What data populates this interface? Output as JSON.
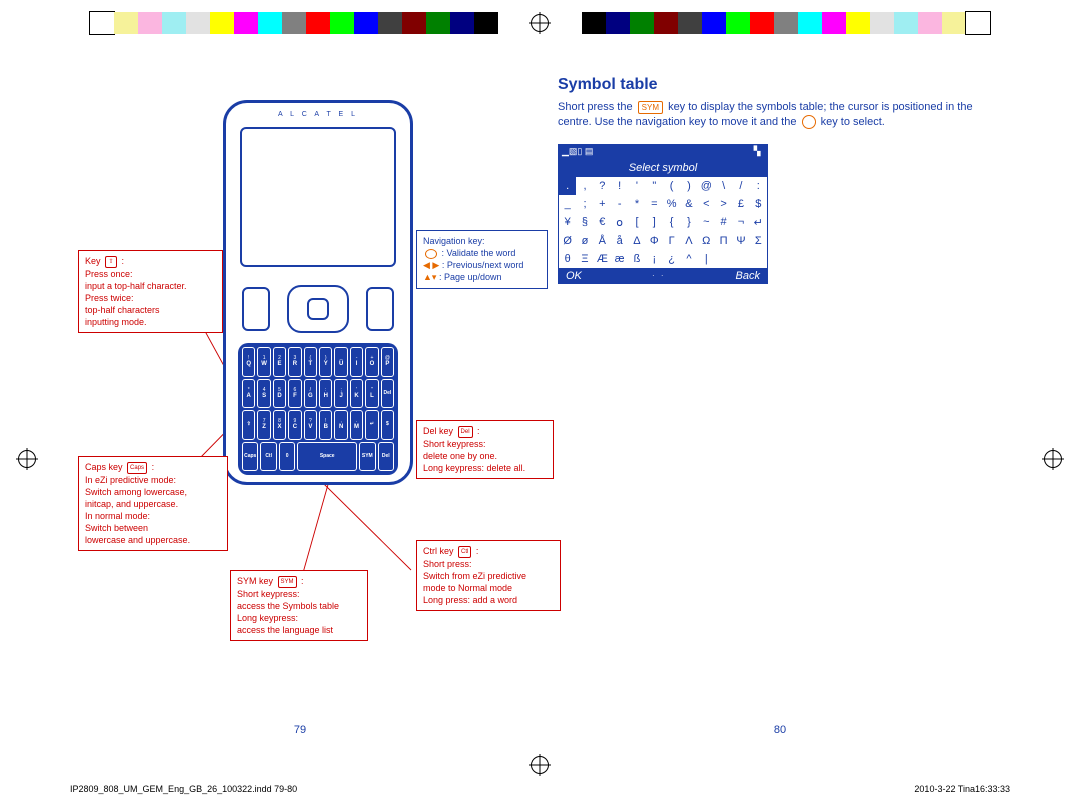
{
  "phone_brand": "A L C A T E L",
  "left": {
    "page_number": "79",
    "key_callout": {
      "title": "Key",
      "keycap": "⇧",
      "line1": "Press once:",
      "line2": "input a top-half character.",
      "line3": "Press twice:",
      "line4": "top-half characters",
      "line5": "inputting mode."
    },
    "caps_callout": {
      "title": "Caps key",
      "keycap": "Caps",
      "line1": "In eZi predictive mode:",
      "line2": "Switch among lowercase,",
      "line3": "initcap, and uppercase.",
      "line4": "In normal mode:",
      "line5": "Switch between",
      "line6": "lowercase and uppercase."
    },
    "sym_callout": {
      "title": "SYM key",
      "keycap": "SYM",
      "line1": "Short keypress:",
      "line2": "access the Symbols table",
      "line3": "Long keypress:",
      "line4": "access the language list"
    },
    "nav_callout": {
      "title": "Navigation key:",
      "ok_label": ": Validate the word",
      "lr_label": ": Previous/next word",
      "ud_label": ": Page up/down"
    },
    "del_callout": {
      "title": "Del key",
      "keycap": "Del",
      "line1": "Short keypress:",
      "line2": "delete one by one.",
      "line3": "Long keypress: delete all."
    },
    "ctrl_callout": {
      "title": "Ctrl key",
      "keycap": "Ctl",
      "line1": "Short press:",
      "line2": "Switch from eZi predictive",
      "line3": "mode to Normal mode",
      "line4": "Long press: add a word"
    },
    "keyboard": [
      [
        [
          "!",
          "Q"
        ],
        [
          "1",
          "W"
        ],
        [
          "2",
          "E"
        ],
        [
          "3",
          "R"
        ],
        [
          "(",
          "T"
        ],
        [
          ")",
          "Y"
        ],
        [
          "_",
          "U"
        ],
        [
          "-",
          "I"
        ],
        [
          "+",
          "O"
        ],
        [
          "@",
          "P"
        ]
      ],
      [
        [
          "*",
          "A"
        ],
        [
          "4",
          "S"
        ],
        [
          "5",
          "D"
        ],
        [
          "6",
          "F"
        ],
        [
          "/",
          "G"
        ],
        [
          ":",
          "H"
        ],
        [
          ";",
          "J"
        ],
        [
          "'",
          "K"
        ],
        [
          "\"",
          "L"
        ],
        [
          "Del",
          ""
        ]
      ],
      [
        [
          "⇧",
          ""
        ],
        [
          "7",
          "Z"
        ],
        [
          "8",
          "X"
        ],
        [
          "9",
          "C"
        ],
        [
          "?",
          "V"
        ],
        [
          "!",
          "B"
        ],
        [
          ",",
          "N"
        ],
        [
          ".",
          "M"
        ],
        [
          "↵",
          ""
        ],
        [
          "$",
          ""
        ]
      ],
      [
        [
          "Caps",
          ""
        ],
        [
          "Ctl",
          ""
        ],
        [
          "0",
          ""
        ],
        [
          "Space",
          ""
        ],
        [
          "SYM",
          ""
        ],
        [
          "Del",
          ""
        ]
      ]
    ]
  },
  "right": {
    "page_number": "80",
    "title": "Symbol table",
    "body_pre": "Short press the",
    "body_key1": "SYM",
    "body_mid1": "key to display the symbols table; the cursor is positioned in the centre. Use the navigation key to move it and the",
    "body_post": "key to select.",
    "screen": {
      "status": "▁▧▯ ▤",
      "signal": "▝▖",
      "title": "Select symbol",
      "rows": [
        [
          ".",
          ",",
          "?",
          "!",
          "'",
          "\"",
          "(",
          ")",
          "@",
          "\\",
          "/",
          ":"
        ],
        [
          "_",
          ";",
          "+",
          "-",
          "*",
          "=",
          "%",
          "&",
          "<",
          ">",
          "£",
          "$"
        ],
        [
          "¥",
          "§",
          "€",
          "𝗈",
          "[",
          "]",
          "{",
          "}",
          "~",
          "#",
          "¬",
          "↵"
        ],
        [
          "Ø",
          "ø",
          "Å",
          "å",
          "Δ",
          "Φ",
          "Γ",
          "Λ",
          "Ω",
          "Π",
          "Ψ",
          "Σ"
        ],
        [
          "θ",
          "Ξ",
          "Æ",
          "æ",
          "ß",
          "¡",
          "¿",
          "^",
          "|",
          "",
          "",
          ""
        ]
      ],
      "soft_left": "OK",
      "soft_right": "Back"
    }
  },
  "imprint": {
    "file": "IP2809_808_UM_GEM_Eng_GB_26_100322.indd   79-80",
    "stamp": "2010-3-22   Tina16:33:33"
  },
  "colorbar": [
    "#fff",
    "#f6f29a",
    "#fbb6e0",
    "#9feef2",
    "#e2e2e2",
    "#ffff00",
    "#ff00ff",
    "#00ffff",
    "#808080",
    "#ff0000",
    "#00ff00",
    "#0000ff",
    "#404040",
    "#800000",
    "#008000",
    "#000080",
    "#000000"
  ]
}
